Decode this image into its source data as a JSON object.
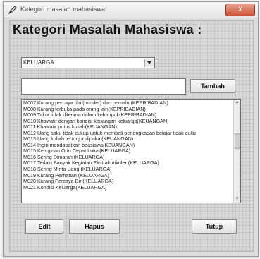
{
  "window": {
    "title": "Kategori masalah mahasiswa",
    "close_label": "x"
  },
  "heading": "Kategori Masalah Mahasiswa :",
  "category_select": {
    "selected": "KELUARGA"
  },
  "problem_input": {
    "value": ""
  },
  "buttons": {
    "tambah": "Tambah",
    "edit": "Edit",
    "hapus": "Hapus",
    "tutup": "Tutup"
  },
  "problem_list": [
    "M007  Kurang percaya diri (minder)  dan pemalu (KEPRIBADIAN)",
    "M008  Kurang terbuka pada orang lain(KEPRIBADIAN)",
    "M009  Takut tidak diterima dalam kelompok(KEPRIBADIAN)",
    "M010  Khawatir dengan kondisi keuangan keluarga(KEUANGAN)",
    "M011  Khawatir putus kuliah(KEUANGAN)",
    "M012  Uang saku tidak cukup untuk membeli perlengkapan belajar tidak cuku",
    "M013  Uang kuliah tertunjur dipakai(KEUANGAN)",
    "M014  Ingin mendapatkan beasiswa(KEUANGAN)",
    "M015  Keinginan Ortu Cepat Lulus(KELUARGA)",
    "M016  Sering Dimarahi(KELUARGA)",
    "M017  Terlalu Banyak Kegiatan Ekstrakurikuler    (KELUARGA)",
    "M018  Sering Minta Uang     (KELUARGA)",
    "M019  Kurang Perhatian      (KELUARGA)",
    "M020  Kurang Percaya Diri(KELUARGA)",
    "M021  Kondisi Keluarga(KELUARGA)"
  ],
  "icons": {
    "app": "pen-icon",
    "dropdown": "chevron-down-icon",
    "scroll_up": "arrow-up-icon",
    "scroll_down": "arrow-down-icon"
  },
  "colors": {
    "close_button": "#c9533a",
    "window_bg": "#dcdcdc"
  }
}
